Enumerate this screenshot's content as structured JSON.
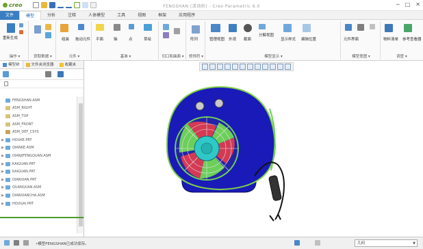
{
  "app": {
    "title": "FENGSHAN (活动的) - Creo Parametric 6.0",
    "logo": "creo"
  },
  "window_controls": [
    "─",
    "□",
    "✕"
  ],
  "ribbon": {
    "tabs": [
      "文件",
      "模型",
      "分析",
      "注释",
      "人体模型",
      "工具",
      "视图",
      "框架",
      "应用程序"
    ],
    "active_tab": "模型",
    "groups": [
      {
        "label": "操作 ▾",
        "buttons": [
          "重新生成"
        ]
      },
      {
        "label": "获取数据 ▾",
        "buttons": [
          "组装",
          "创建"
        ]
      },
      {
        "label": "元件 ▾",
        "buttons": [
          "拖动元件",
          "阵列"
        ]
      },
      {
        "label": "基准 ▾",
        "buttons": [
          "平面",
          "轴",
          "点",
          "草绘"
        ]
      },
      {
        "label": "切口和曲面 ▾",
        "buttons": [
          "拉伸",
          "旋转",
          "扫描"
        ]
      },
      {
        "label": "修饰符 ▾",
        "buttons": [
          "阵列"
        ]
      },
      {
        "label": "模型显示 ▾",
        "buttons": [
          "管理视图",
          "外观",
          "截面",
          "分解视图",
          "显示样式",
          "编辑位置"
        ]
      },
      {
        "label": "模型意图 ▾",
        "buttons": [
          "元件界面",
          "骨架模型",
          "参数",
          "关系",
          "族表"
        ]
      },
      {
        "label": "调查 ▾",
        "buttons": [
          "物料清单",
          "参考查看器"
        ]
      }
    ]
  },
  "left_panel": {
    "tabs": [
      "模型树",
      "文件夹浏览器",
      "收藏夹"
    ],
    "tree_title": "FENGSHAN.ASM",
    "tree_items": [
      {
        "name": "ASM_RIGHT",
        "kind": "datum"
      },
      {
        "name": "ASM_TOP",
        "kind": "datum"
      },
      {
        "name": "ASM_FRONT",
        "kind": "datum"
      },
      {
        "name": "ASM_DEF_CSYS",
        "kind": "csys"
      },
      {
        "name": "HOUKE.PRT",
        "kind": "part"
      },
      {
        "name": "QIANKE.ASM",
        "kind": "part"
      },
      {
        "name": "DIANJIFENGQUAN.ASM",
        "kind": "part"
      },
      {
        "name": "KAIGUAN.PRT",
        "kind": "part"
      },
      {
        "name": "KAIGUAN.PRT",
        "kind": "part"
      },
      {
        "name": "DIANXIAN.PRT",
        "kind": "part"
      },
      {
        "name": "QUANQUAN.ASM",
        "kind": "part"
      },
      {
        "name": "DIANXIANCHA.ASM",
        "kind": "part"
      },
      {
        "name": "HOUGAI.PRT",
        "kind": "part"
      }
    ]
  },
  "status": {
    "message": "•模型FENGSHAN已成功保存。",
    "filter": "几何"
  },
  "colors": {
    "file_tab": "#3a7fc1",
    "body_blue": "#1a1ab8",
    "impeller": "#2fc8c8",
    "blade_red": "#d43a54",
    "blade_green": "#6ccf5a",
    "cord": "#111111"
  }
}
